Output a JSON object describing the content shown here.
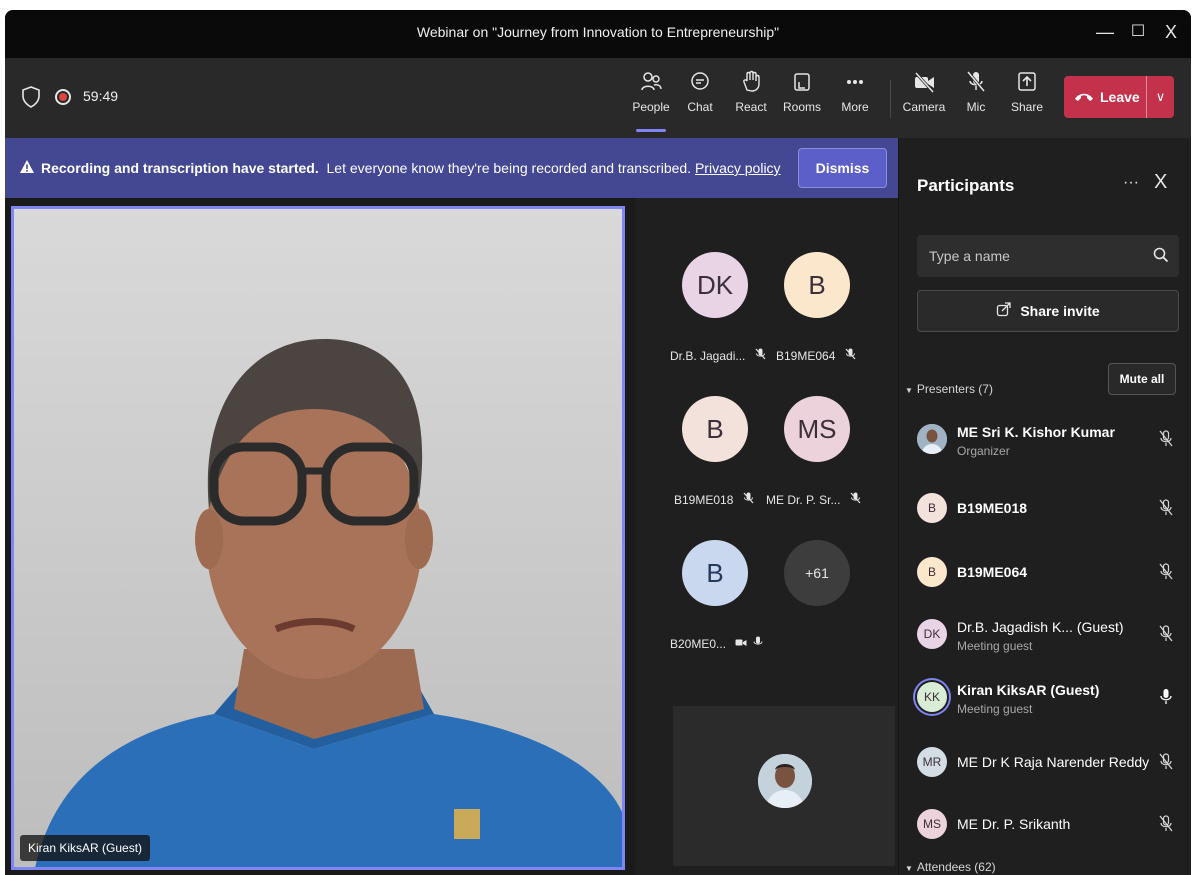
{
  "window": {
    "title": "Webinar on \"Journey from Innovation to Entrepreneurship\"",
    "controls": {
      "minimize": "—",
      "maximize": "☐",
      "close": "X"
    }
  },
  "toolbar": {
    "timer": "59:49",
    "buttons": {
      "people": "People",
      "chat": "Chat",
      "react": "React",
      "rooms": "Rooms",
      "more": "More",
      "camera": "Camera",
      "mic": "Mic",
      "share": "Share"
    },
    "leave_label": "Leave",
    "leave_chevron": "∨",
    "accent_color": "#c4314b"
  },
  "banner": {
    "bold_text": "Recording and transcription have started.",
    "text": "Let everyone know they're being recorded and transcribed.",
    "link": "Privacy policy",
    "dismiss_label": "Dismiss"
  },
  "stage": {
    "speaker_name": "Kiran KiksAR (Guest)",
    "tiles": [
      {
        "initials": "DK",
        "name": "Dr.B. Jagadi...",
        "color": "#e9d4e6"
      },
      {
        "initials": "B",
        "name": "B19ME064",
        "color": "#fbe7cc"
      },
      {
        "initials": "B",
        "name": "B19ME018",
        "color": "#f3e1dc"
      },
      {
        "initials": "MS",
        "name": "ME Dr. P. Sr...",
        "color": "#ecd2da"
      },
      {
        "initials": "B",
        "name": "B20ME0...",
        "color": "#cad8ef"
      },
      {
        "initials": "+61",
        "name": "",
        "color": "#3d3d3d"
      }
    ]
  },
  "panel": {
    "title": "Participants",
    "more": "···",
    "close": "X",
    "search_placeholder": "Type a name",
    "share_invite_label": "Share invite",
    "presenters_label": "Presenters (7)",
    "mute_all_label": "Mute all",
    "attendees_label": "Attendees (62)",
    "presenters": [
      {
        "initials": "",
        "name": "ME Sri K. Kishor Kumar",
        "role": "Organizer",
        "mic": "muted",
        "photo": true,
        "color": "#9fb3c4"
      },
      {
        "initials": "B",
        "name": "B19ME018",
        "role": "",
        "mic": "muted",
        "color": "#f3e1dc"
      },
      {
        "initials": "B",
        "name": "B19ME064",
        "role": "",
        "mic": "muted",
        "color": "#fbe7cc"
      },
      {
        "initials": "DK",
        "name": "Dr.B. Jagadish K...  (Guest)",
        "role": "Meeting guest",
        "mic": "muted",
        "color": "#e9d4e6"
      },
      {
        "initials": "KK",
        "name": "Kiran KiksAR (Guest)",
        "role": "Meeting guest",
        "mic": "on",
        "color": "#d9ecd6"
      },
      {
        "initials": "MR",
        "name": "ME Dr K Raja Narender Reddy",
        "role": "",
        "mic": "muted",
        "color": "#d3dde3"
      },
      {
        "initials": "MS",
        "name": "ME Dr. P. Srikanth",
        "role": "",
        "mic": "muted",
        "color": "#ecd2da"
      }
    ]
  }
}
